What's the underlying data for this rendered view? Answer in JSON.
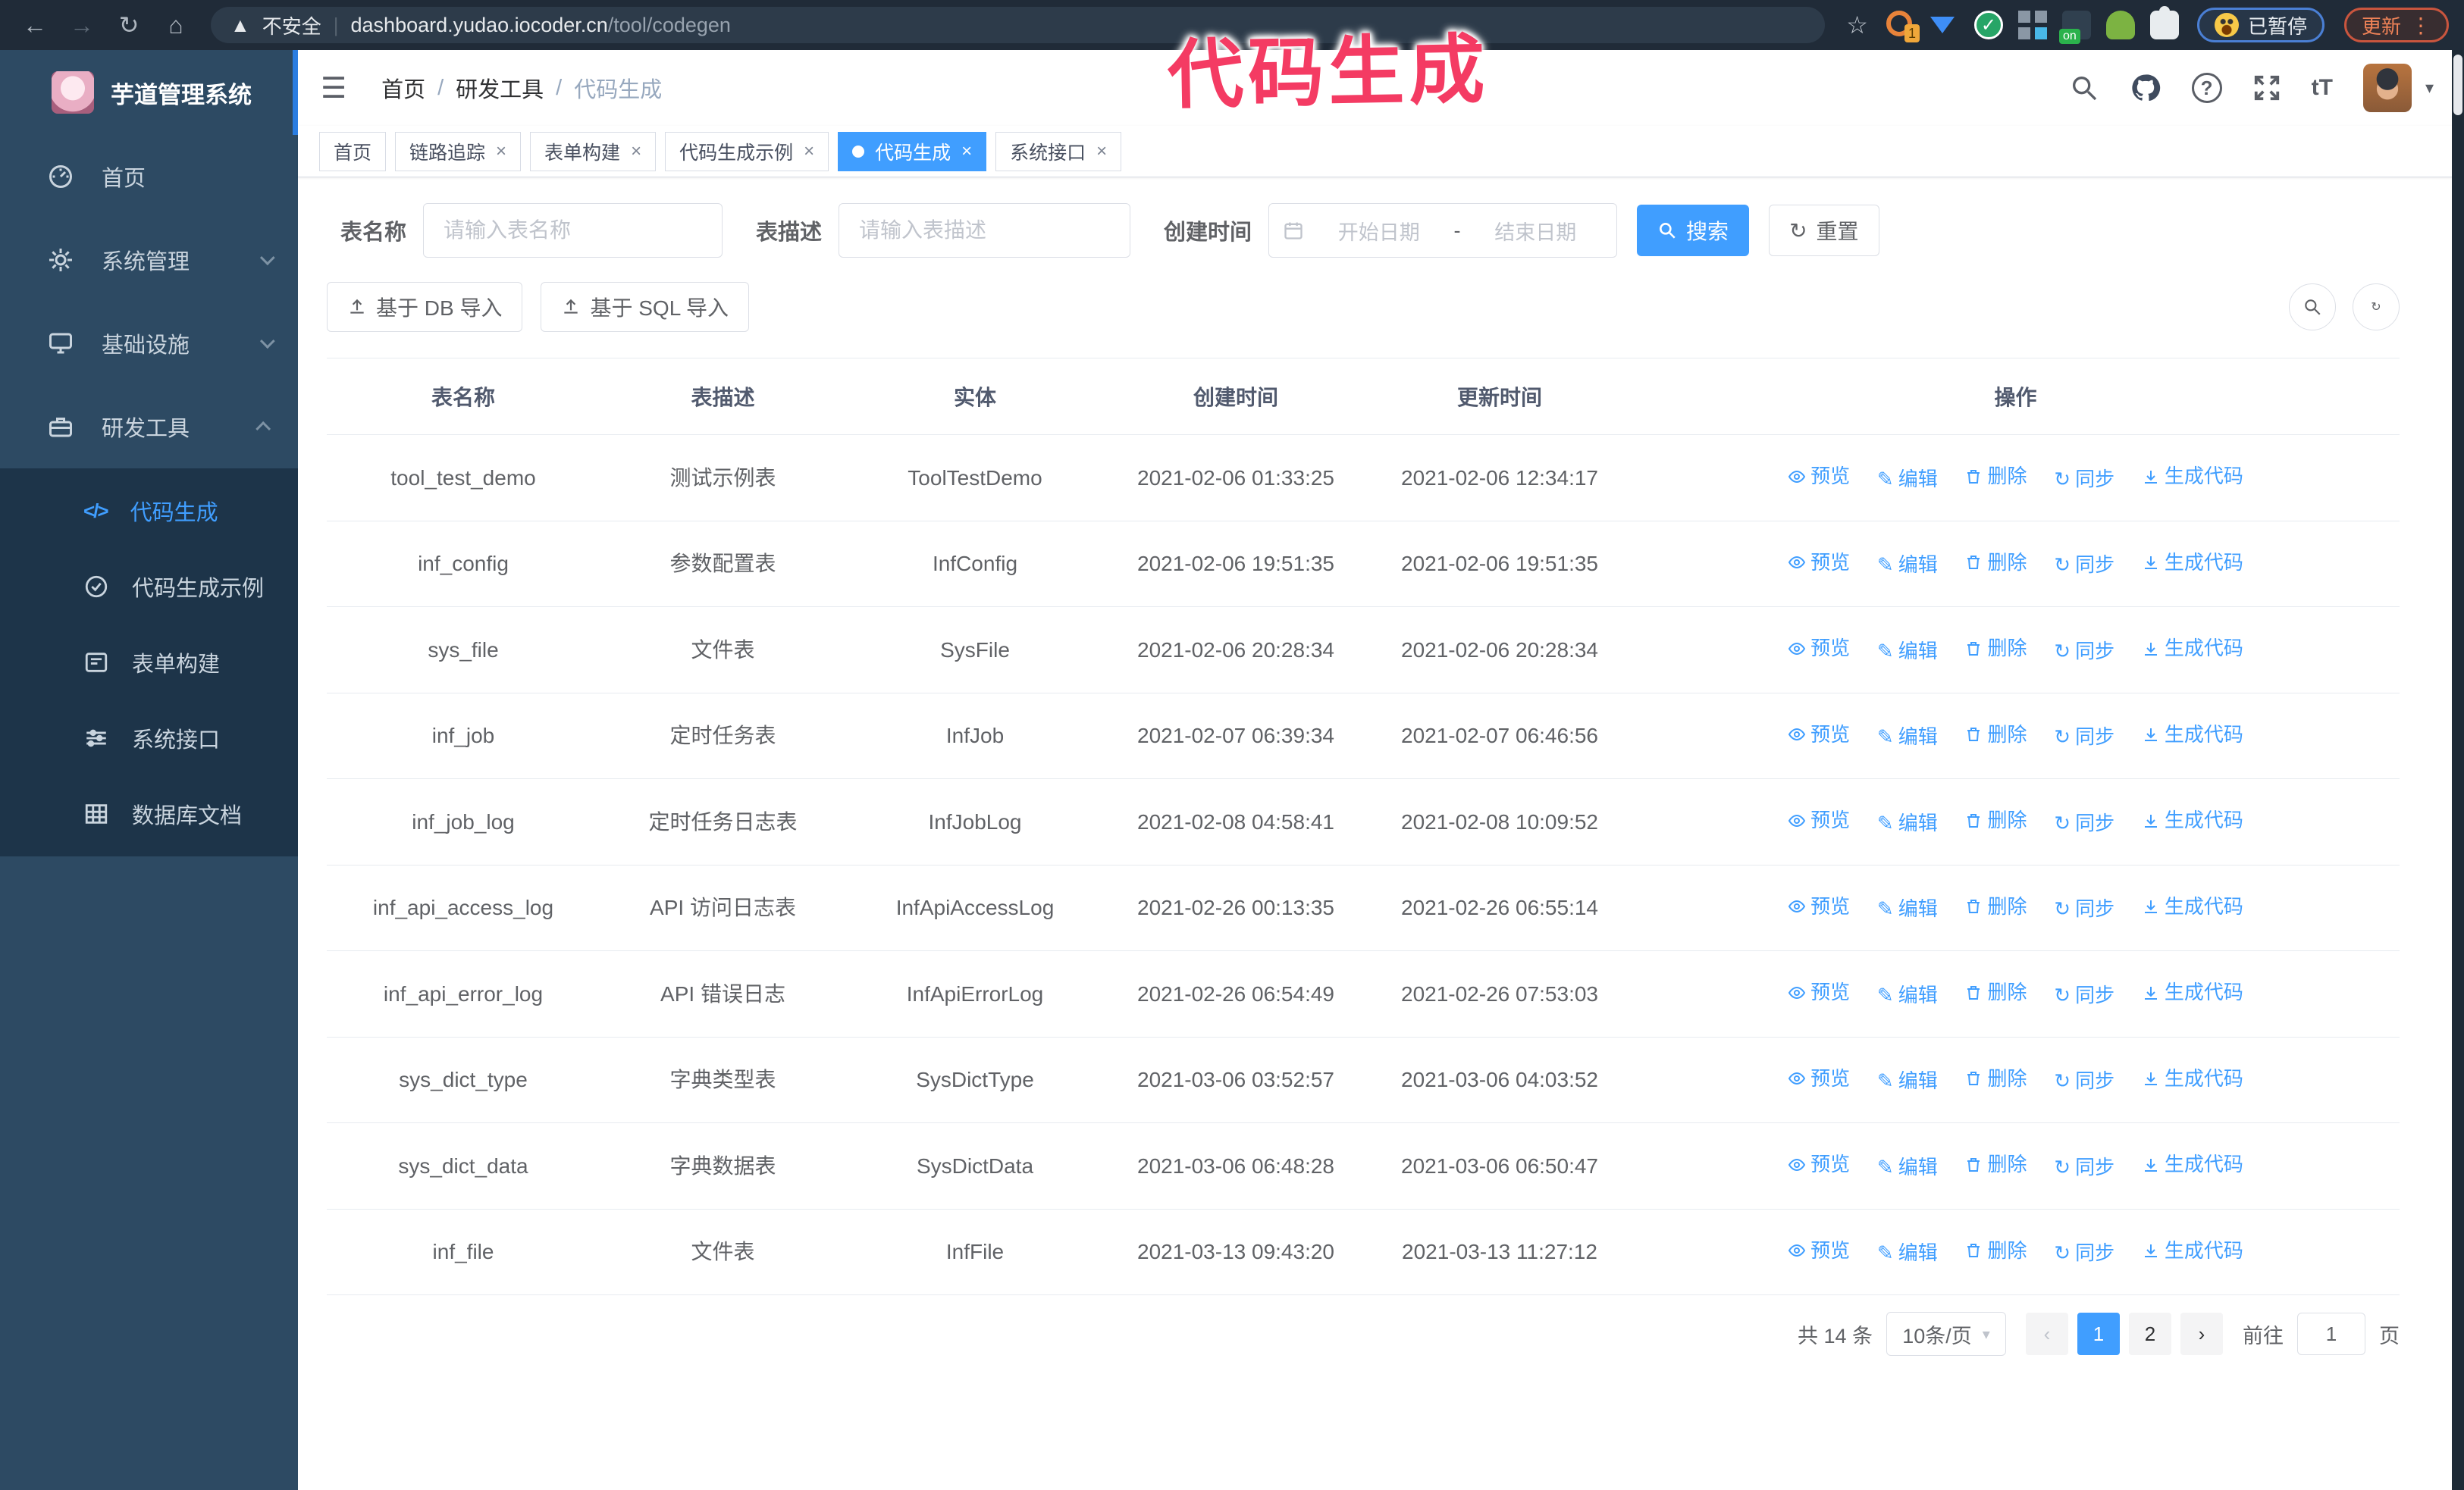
{
  "browser": {
    "security_label": "不安全",
    "url_host": "dashboard.yudao.iocoder.cn",
    "url_path": "/tool/codegen",
    "extension_badge": "1",
    "extension_on_badge": "on",
    "paused_badge": "已暂停",
    "update_button": "更新"
  },
  "annotation": {
    "text": "代码生成",
    "color": "#f43b63"
  },
  "sidebar": {
    "logo_title": "芋道管理系统",
    "items": [
      {
        "label": "首页"
      },
      {
        "label": "系统管理"
      },
      {
        "label": "基础设施"
      },
      {
        "label": "研发工具"
      }
    ],
    "submenu": [
      {
        "label": "代码生成"
      },
      {
        "label": "代码生成示例"
      },
      {
        "label": "表单构建"
      },
      {
        "label": "系统接口"
      },
      {
        "label": "数据库文档"
      }
    ]
  },
  "breadcrumb": {
    "home": "首页",
    "section": "研发工具",
    "current": "代码生成",
    "separator": "/"
  },
  "tabs": [
    {
      "label": "首页"
    },
    {
      "label": "链路追踪"
    },
    {
      "label": "表单构建"
    },
    {
      "label": "代码生成示例"
    },
    {
      "label": "代码生成"
    },
    {
      "label": "系统接口"
    }
  ],
  "filters": {
    "name_label": "表名称",
    "name_placeholder": "请输入表名称",
    "desc_label": "表描述",
    "desc_placeholder": "请输入表描述",
    "time_label": "创建时间",
    "start_placeholder": "开始日期",
    "end_placeholder": "结束日期",
    "range_separator": "-",
    "search_button": "搜索",
    "reset_button": "重置"
  },
  "toolbar": {
    "import_db_button": "基于 DB 导入",
    "import_sql_button": "基于 SQL 导入"
  },
  "table": {
    "headers": [
      "表名称",
      "表描述",
      "实体",
      "创建时间",
      "更新时间",
      "操作"
    ],
    "action_labels": {
      "preview": "预览",
      "edit": "编辑",
      "delete": "删除",
      "sync": "同步",
      "generate": "生成代码"
    },
    "rows": [
      {
        "name": "tool_test_demo",
        "desc": "测试示例表",
        "entity": "ToolTestDemo",
        "created": "2021-02-06 01:33:25",
        "updated": "2021-02-06 12:34:17"
      },
      {
        "name": "inf_config",
        "desc": "参数配置表",
        "entity": "InfConfig",
        "created": "2021-02-06 19:51:35",
        "updated": "2021-02-06 19:51:35"
      },
      {
        "name": "sys_file",
        "desc": "文件表",
        "entity": "SysFile",
        "created": "2021-02-06 20:28:34",
        "updated": "2021-02-06 20:28:34"
      },
      {
        "name": "inf_job",
        "desc": "定时任务表",
        "entity": "InfJob",
        "created": "2021-02-07 06:39:34",
        "updated": "2021-02-07 06:46:56"
      },
      {
        "name": "inf_job_log",
        "desc": "定时任务日志表",
        "entity": "InfJobLog",
        "created": "2021-02-08 04:58:41",
        "updated": "2021-02-08 10:09:52"
      },
      {
        "name": "inf_api_access_log",
        "desc": "API 访问日志表",
        "entity": "InfApiAccessLog",
        "created": "2021-02-26 00:13:35",
        "updated": "2021-02-26 06:55:14"
      },
      {
        "name": "inf_api_error_log",
        "desc": "API 错误日志",
        "entity": "InfApiErrorLog",
        "created": "2021-02-26 06:54:49",
        "updated": "2021-02-26 07:53:03"
      },
      {
        "name": "sys_dict_type",
        "desc": "字典类型表",
        "entity": "SysDictType",
        "created": "2021-03-06 03:52:57",
        "updated": "2021-03-06 04:03:52"
      },
      {
        "name": "sys_dict_data",
        "desc": "字典数据表",
        "entity": "SysDictData",
        "created": "2021-03-06 06:48:28",
        "updated": "2021-03-06 06:50:47"
      },
      {
        "name": "inf_file",
        "desc": "文件表",
        "entity": "InfFile",
        "created": "2021-03-13 09:43:20",
        "updated": "2021-03-13 11:27:12"
      }
    ]
  },
  "pagination": {
    "total": "共 14 条",
    "page_size": "10条/页",
    "page_1": "1",
    "page_2": "2",
    "goto_label": "前往",
    "goto_value": "1",
    "page_unit": "页"
  },
  "colors": {
    "primary": "#409eff",
    "annotation_pink": "#f43b63",
    "sidebar_bg": "#2d4a63",
    "submenu_bg": "#1d3449",
    "chrome_bg": "#202b38"
  }
}
